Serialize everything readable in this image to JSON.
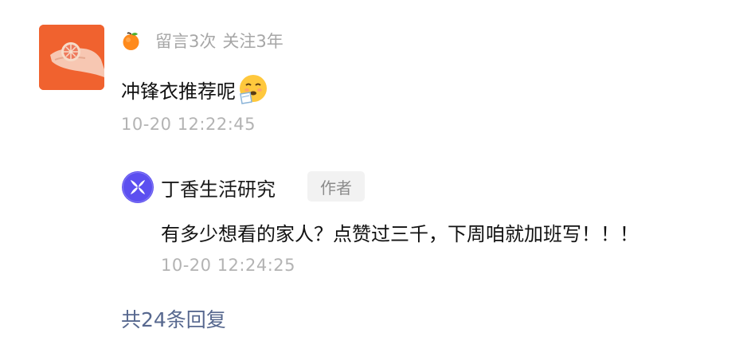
{
  "comment": {
    "avatar_icon": "hand-holding-grapefruit-avatar",
    "badge_icon": "orange-fruit-icon",
    "stats_messages": "留言3次",
    "stats_follow": "关注3年",
    "text": "冲锋衣推荐呢",
    "emoji_icon": "sick-face-emoji",
    "timestamp": "10-20 12:22:45"
  },
  "reply": {
    "avatar_icon": "flower-logo-icon",
    "author_name": "丁香生活研究",
    "author_badge": "作者",
    "text": "有多少想看的家人？点赞过三千，下周咱就加班写！！！",
    "timestamp": "10-20 12:24:25"
  },
  "more_replies": "共24条回复",
  "colors": {
    "avatar_bg": "#f0622f",
    "brand_purple": "#5c4ff0",
    "link": "#57688f",
    "muted": "#a6a6a6"
  }
}
